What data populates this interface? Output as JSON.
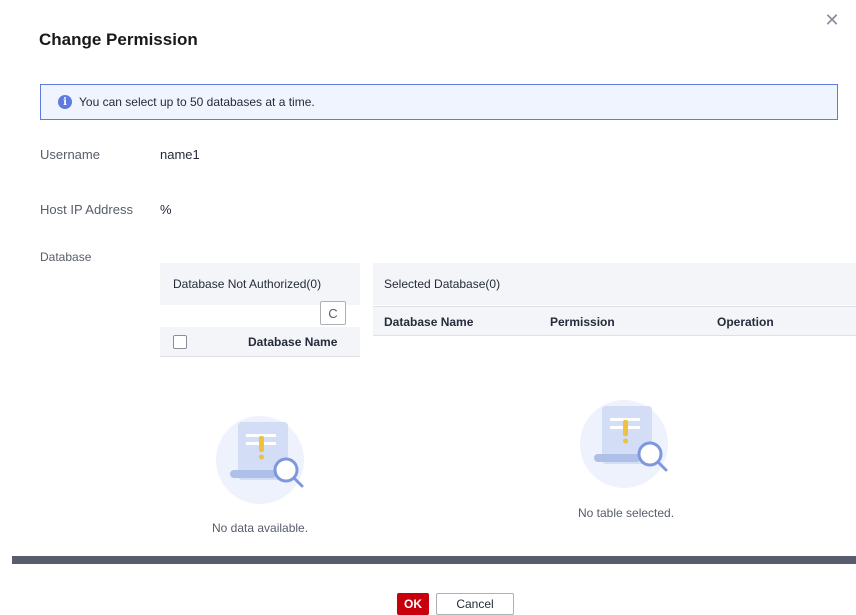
{
  "dialog": {
    "title": "Change Permission",
    "close_icon": "close-icon",
    "notice": {
      "icon": "info-icon",
      "text": "You can select up to 50 databases at a time."
    }
  },
  "form": {
    "username_label": "Username",
    "username_value": "name1",
    "host_label": "Host IP Address",
    "host_value": "%",
    "database_label": "Database"
  },
  "left_panel": {
    "title": "Database Not Authorized(0)",
    "refresh_icon": "refresh-icon",
    "column": "Database Name",
    "empty_text": "No data available."
  },
  "right_panel": {
    "title": "Selected Database(0)",
    "columns": [
      "Database Name",
      "Permission",
      "Operation"
    ],
    "empty_text": "No table selected."
  },
  "footer": {
    "ok_label": "OK",
    "cancel_label": "Cancel"
  },
  "colors": {
    "accent": "#5e7ce0",
    "primary_button": "#c7000b"
  }
}
